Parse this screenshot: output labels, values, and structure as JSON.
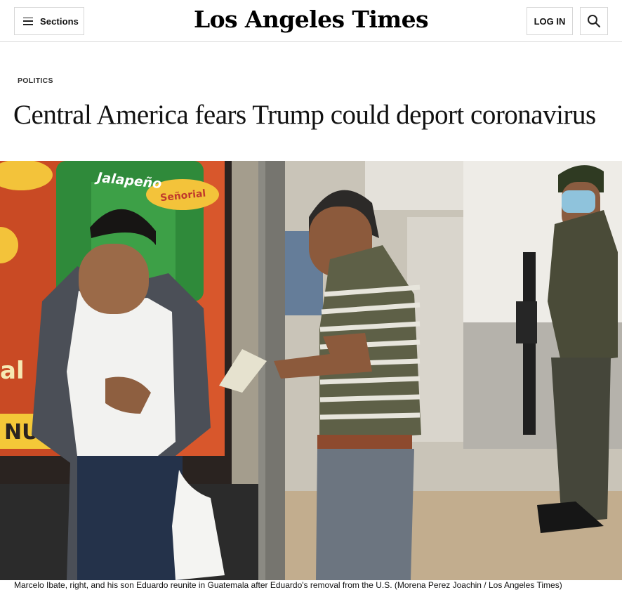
{
  "header": {
    "sections_label": "Sections",
    "masthead": "Los Angeles Times",
    "login_label": "LOG IN"
  },
  "article": {
    "kicker": "POLITICS",
    "headline": "Central America fears Trump could deport coronavirus",
    "caption": "Marcelo Ibate, right, and his son Eduardo reunite in Guatemala after Eduardo's removal from the U.S. (Morena Perez Joachin / Los Angeles Times)"
  },
  "photo_signage": {
    "sign_word": "Jalapeño",
    "brand": "Señorial",
    "fragment_left": "al",
    "fragment_bottom": "NUEV"
  },
  "icons": {
    "menu": "hamburger-icon",
    "search": "search-icon"
  }
}
